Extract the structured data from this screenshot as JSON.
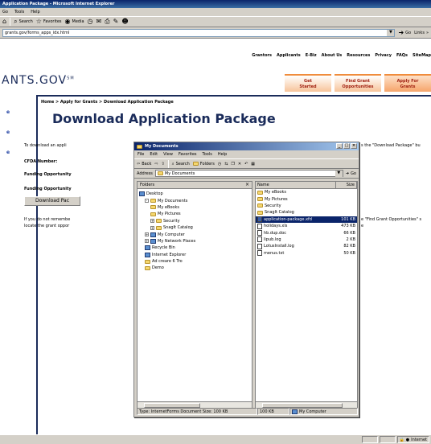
{
  "browser": {
    "title": "Application Package - Microsoft Internet Explorer",
    "menu": [
      "Go",
      "Tools",
      "Help"
    ],
    "toolbar": {
      "search": "Search",
      "favorites": "Favorites",
      "media": "Media"
    },
    "address": "grants.gov/forms_apps_idx.html",
    "go_label": "Go",
    "links_label": "Links",
    "status_zone": "Internet"
  },
  "site": {
    "top_nav": [
      "Grantors",
      "Applicants",
      "E-Biz",
      "About Us",
      "Resources",
      "Privacy",
      "FAQs",
      "SiteMap"
    ],
    "logo": "ANTS.GOV",
    "logo_mark": "SM",
    "nav_tabs": [
      {
        "line1": "Get",
        "line2": "Started"
      },
      {
        "line1": "Find Grant",
        "line2": "Opportunities"
      },
      {
        "line1": "Apply For",
        "line2": "Grants"
      }
    ],
    "breadcrumb": "Home > Apply for Grants > Download Application Package",
    "title": "Download Application Package",
    "side_links": [
      "e",
      "e",
      "e"
    ],
    "intro_text": "To download an appli",
    "intro_right": "s the \"Download Package\" bu",
    "cfda_label": "CFDA Number:",
    "funding_label_1": "Funding Opportunity",
    "funding_label_2": "Funding Opportunity",
    "download_button": "Download Pac",
    "remember_text_1": "If you do not remembe",
    "remember_text_2": "locate the grant oppor",
    "remember_right_1": "e \"Find Grant Opportunities\" s",
    "remember_right_2": "e"
  },
  "dialog": {
    "title": "My Documents",
    "menu": [
      "File",
      "Edit",
      "View",
      "Favorites",
      "Tools",
      "Help"
    ],
    "toolbar": {
      "back": "Back",
      "search": "Search",
      "folders": "Folders"
    },
    "address_label": "Address",
    "address_value": "My Documents",
    "go_label": "Go",
    "folders_header": "Folders",
    "tree": [
      {
        "label": "Desktop",
        "indent": 0,
        "type": "desktop"
      },
      {
        "label": "My Documents",
        "indent": 1,
        "type": "folder",
        "expander": "-"
      },
      {
        "label": "My eBooks",
        "indent": 2,
        "type": "folder"
      },
      {
        "label": "My Pictures",
        "indent": 2,
        "type": "folder"
      },
      {
        "label": "Security",
        "indent": 2,
        "type": "folder",
        "expander": "+"
      },
      {
        "label": "SnagIt Catalog",
        "indent": 2,
        "type": "folder",
        "expander": "+"
      },
      {
        "label": "My Computer",
        "indent": 1,
        "type": "pc",
        "expander": "+"
      },
      {
        "label": "My Network Places",
        "indent": 1,
        "type": "pc",
        "expander": "+"
      },
      {
        "label": "Recycle Bin",
        "indent": 1,
        "type": "pc"
      },
      {
        "label": "Internet Explorer",
        "indent": 1,
        "type": "pc"
      },
      {
        "label": "Ad creare 6 Tro",
        "indent": 1,
        "type": "folder"
      },
      {
        "label": "Demo",
        "indent": 1,
        "type": "folder"
      }
    ],
    "columns": {
      "name": "Name",
      "size": "Size"
    },
    "files": [
      {
        "name": "My eBooks",
        "size": "",
        "type": "folder"
      },
      {
        "name": "My Pictures",
        "size": "",
        "type": "folder"
      },
      {
        "name": "Security",
        "size": "",
        "type": "folder"
      },
      {
        "name": "SnagIt Catalog",
        "size": "",
        "type": "folder"
      },
      {
        "name": "application-package.xfd",
        "size": "101 KB",
        "type": "xfd",
        "selected": true
      },
      {
        "name": "holidays.xls",
        "size": "473 KB",
        "type": "doc"
      },
      {
        "name": "hb.dup.doc",
        "size": "66 KB",
        "type": "doc"
      },
      {
        "name": "lipub.log",
        "size": "2 KB",
        "type": "doc"
      },
      {
        "name": "LotusInstall.log",
        "size": "82 KB",
        "type": "doc"
      },
      {
        "name": "menus.txt",
        "size": "50 KB",
        "type": "doc"
      }
    ],
    "status": {
      "type_info": "Type: InternetForms Document Size: 100 KB",
      "size": "100 KB",
      "location": "My Computer"
    }
  }
}
